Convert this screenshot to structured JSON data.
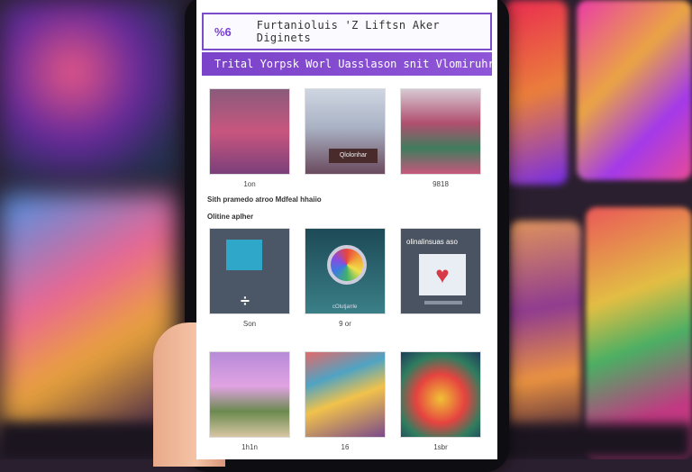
{
  "app": {
    "badge": "%6",
    "title": "Furtanioluis 'Z Liftsn Aker Diginets",
    "banner": "Trital Yorpsk Worl Uasslason snit Vlomiruhr"
  },
  "section1": {
    "tiles": [
      {
        "caption": "1on",
        "thumb_icon": "city-art-thumb"
      },
      {
        "caption": "",
        "thumb_icon": "street-art-thumb",
        "overlay": "Qlolonhar"
      },
      {
        "caption": "9818",
        "thumb_icon": "garden-art-thumb"
      }
    ],
    "footer": "Sith pramedo atroo Mdfeal hhaiio"
  },
  "section2": {
    "heading": "Olitine aplher",
    "tiles": [
      {
        "caption": "Son",
        "thumb_icon": "screen-plus-thumb"
      },
      {
        "caption": "9 or",
        "thumb_icon": "camera-lens-thumb",
        "overlay": "cOlutjarrle"
      },
      {
        "caption": "",
        "thumb_icon": "heart-card-thumb",
        "overlay": "olinalinsuas aso"
      }
    ]
  },
  "section3": {
    "tiles": [
      {
        "caption": "1h1n",
        "thumb_icon": "pixel-city-thumb"
      },
      {
        "caption": "16",
        "thumb_icon": "mosaic-thumb"
      },
      {
        "caption": "1sbr",
        "thumb_icon": "flower-thumb"
      }
    ]
  }
}
